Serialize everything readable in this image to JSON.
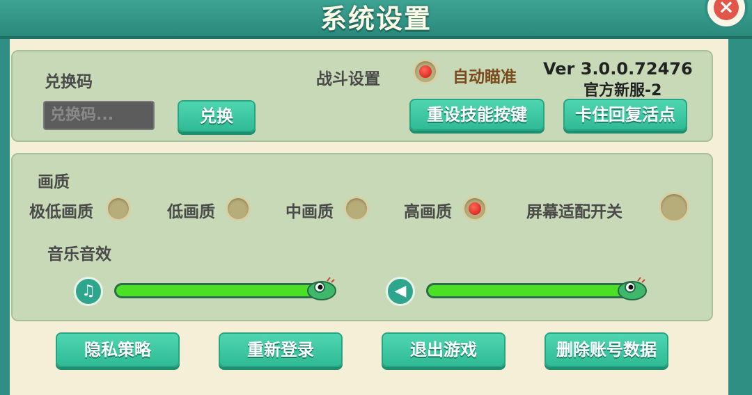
{
  "title": "系统设置",
  "close_symbol": "×",
  "redeem": {
    "label": "兑换码",
    "placeholder": "兑换码...",
    "button": "兑换"
  },
  "battle": {
    "label": "战斗设置",
    "auto_aim_label": "自动瞄准",
    "auto_aim_on": true
  },
  "version": {
    "line1": "Ver 3.0.0.72476",
    "line2": "官方新服-2"
  },
  "buttons": {
    "reset_skill": "重设技能按键",
    "stuck_recover": "卡住回复活点"
  },
  "quality": {
    "label": "画质",
    "options": [
      {
        "label": "极低画质",
        "selected": false
      },
      {
        "label": "低画质",
        "selected": false
      },
      {
        "label": "中画质",
        "selected": false
      },
      {
        "label": "高画质",
        "selected": true
      }
    ],
    "screen_fit_label": "屏幕适配开关",
    "screen_fit_on": false
  },
  "audio": {
    "label": "音乐音效",
    "music_level": 1.0,
    "sfx_level": 1.0,
    "music_icon": "music-note-icon",
    "sfx_icon": "speaker-icon"
  },
  "bottom_buttons": {
    "privacy": "隐私策略",
    "relogin": "重新登录",
    "exit": "退出游戏",
    "delete_data": "删除账号数据"
  },
  "colors": {
    "accent": "#2fbb95",
    "slider_fill": "#4be025",
    "radio_on": "#d20f0f",
    "title_bar": "#2f8f83"
  }
}
